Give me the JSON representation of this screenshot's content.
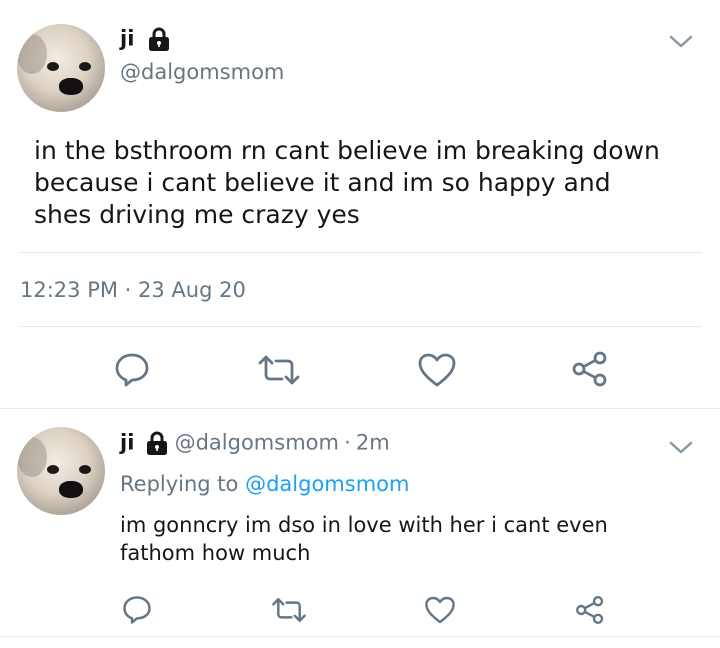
{
  "main_tweet": {
    "name": "ji",
    "handle": "@dalgomsmom",
    "text": "in the bsthroom rn cant believe im breaking down because i cant believe it and im so happy and shes driving me crazy yes",
    "timestamp": "12:23 PM · 23 Aug 20",
    "icons": [
      "lock-icon",
      "chevron-down-icon",
      "reply-icon",
      "retweet-icon",
      "like-icon",
      "share-icon"
    ]
  },
  "reply_tweet": {
    "name": "ji",
    "handle": "@dalgomsmom",
    "time_sep": "·",
    "time": "2m",
    "replying_prefix": "Replying to",
    "replying_handle": "@dalgomsmom",
    "text": "im gonncry im dso in love with her i cant even fathom how much"
  },
  "colors": {
    "text": "#14171a",
    "secondary": "#657786",
    "link": "#1da1f2",
    "divider": "#e1e8ed"
  }
}
